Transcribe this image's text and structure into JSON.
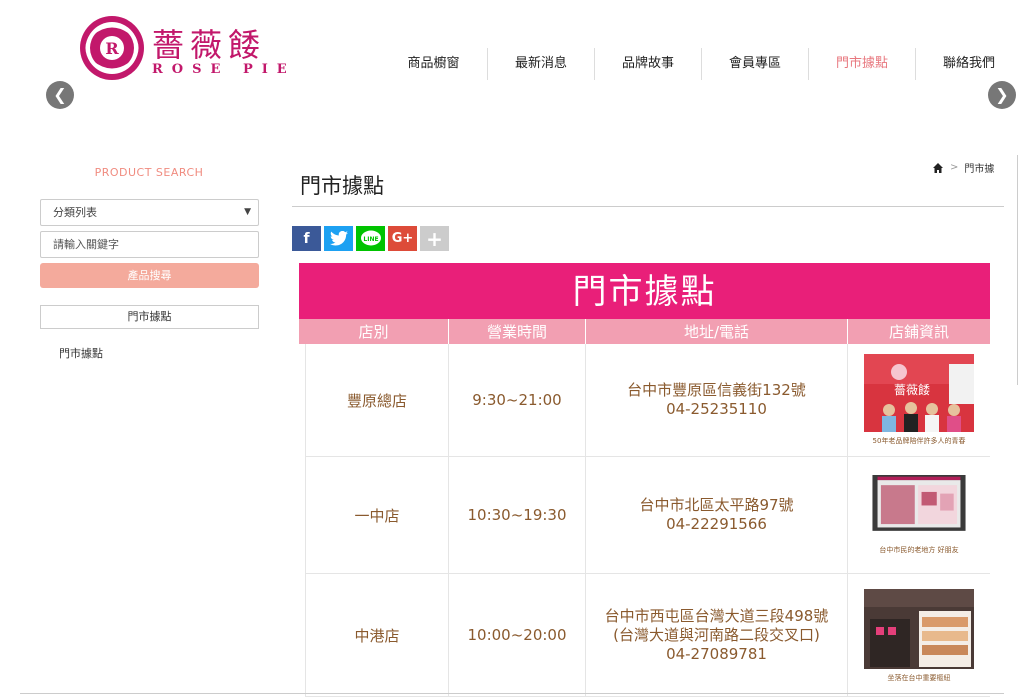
{
  "brand": {
    "name_cn": "薔薇餧",
    "name_en": "ROSE PIE",
    "color": "#c2186b"
  },
  "nav": [
    {
      "label": "商品櫥窗"
    },
    {
      "label": "最新消息"
    },
    {
      "label": "品牌故事"
    },
    {
      "label": "會員專區"
    },
    {
      "label": "門市據點",
      "active": true
    },
    {
      "label": "聯絡我們"
    }
  ],
  "slider": {
    "prev_icon": "chevron-left-icon",
    "next_icon": "chevron-right-icon"
  },
  "sidebar": {
    "title": "PRODUCT SEARCH",
    "category_select": "分類列表",
    "keyword_placeholder": "請輸入關鍵字",
    "search_button": "產品搜尋",
    "category_box": "門市據點",
    "links": [
      "門市據點"
    ]
  },
  "page": {
    "title": "門市據點",
    "breadcrumb": {
      "separator": ">",
      "current": "門市據"
    }
  },
  "share": {
    "facebook": "f",
    "twitter": "t",
    "line": "LINE",
    "google": "G+",
    "more": "+"
  },
  "stores": {
    "banner": "門市據點",
    "headers": [
      "店別",
      "營業時間",
      "地址/電話",
      "店鋪資訊"
    ],
    "rows": [
      {
        "name": "豐原總店",
        "hours": "9:30~21:00",
        "address_line1": "台中市豐原區信義街132號",
        "address_line2": "",
        "phone": "04-25235110",
        "caption": "50年老品牌陪伴許多人的青春"
      },
      {
        "name": "一中店",
        "hours": "10:30~19:30",
        "address_line1": "台中市北區太平路97號",
        "address_line2": "",
        "phone": "04-22291566",
        "caption": "台中市民的老地方 好朋友"
      },
      {
        "name": "中港店",
        "hours": "10:00~20:00",
        "address_line1": "台中市西屯區台灣大道三段498號",
        "address_line2": "(台灣大道與河南路二段交叉口)",
        "phone": "04-27089781",
        "caption": "坐落在台中重要樞紐"
      }
    ]
  },
  "colors": {
    "accent_pink": "#e91f79",
    "header_pink": "#f29fb2",
    "search_button": "#f4aa9c",
    "text_brown": "#8a5a2e"
  }
}
